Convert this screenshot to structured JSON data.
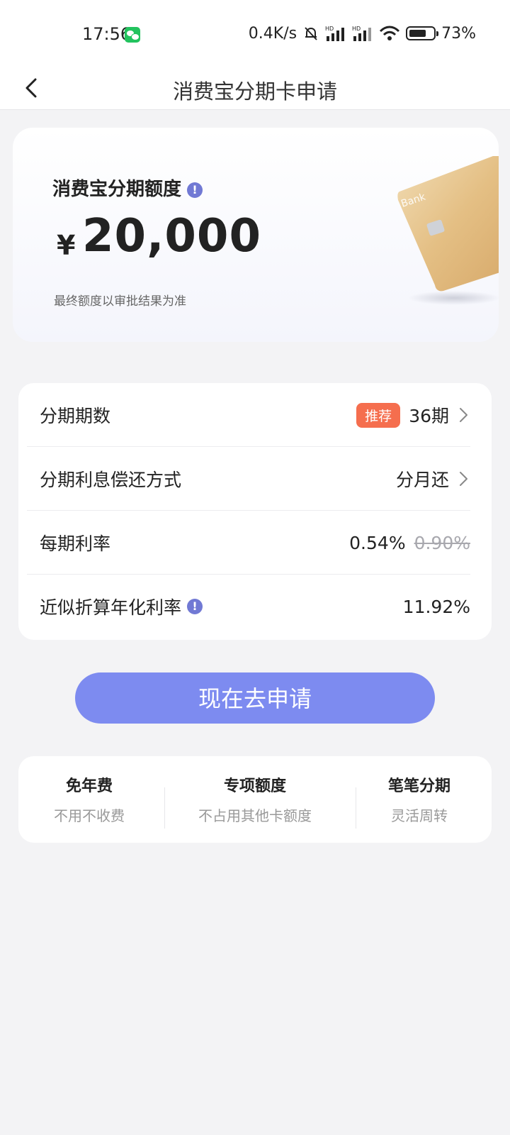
{
  "status_bar": {
    "time": "17:56",
    "network_speed": "0.4K/s",
    "signal_label": "HD",
    "battery": "73%",
    "battery_level": 0.73
  },
  "nav": {
    "title": "消费宝分期卡申请"
  },
  "quota": {
    "label": "消费宝分期额度",
    "info_mark": "!",
    "currency": "¥",
    "amount": "20,000",
    "note": "最终额度以审批结果为准"
  },
  "details": {
    "installments": {
      "label": "分期期数",
      "badge": "推荐",
      "value": "36期"
    },
    "repayment": {
      "label": "分期利息偿还方式",
      "value": "分月还"
    },
    "rate": {
      "label": "每期利率",
      "value": "0.54%",
      "original": "0.90%"
    },
    "annual_rate": {
      "label": "近似折算年化利率",
      "info_mark": "!",
      "value": "11.92%"
    }
  },
  "apply_button": {
    "label": "现在去申请"
  },
  "features": [
    {
      "title": "免年费",
      "subtitle": "不用不收费"
    },
    {
      "title": "专项额度",
      "subtitle": "不占用其他卡额度"
    },
    {
      "title": "笔笔分期",
      "subtitle": "灵活周转"
    }
  ],
  "colors": {
    "accent": "#7d8bf0",
    "badge": "#f56e4e",
    "info": "#7179d4"
  }
}
